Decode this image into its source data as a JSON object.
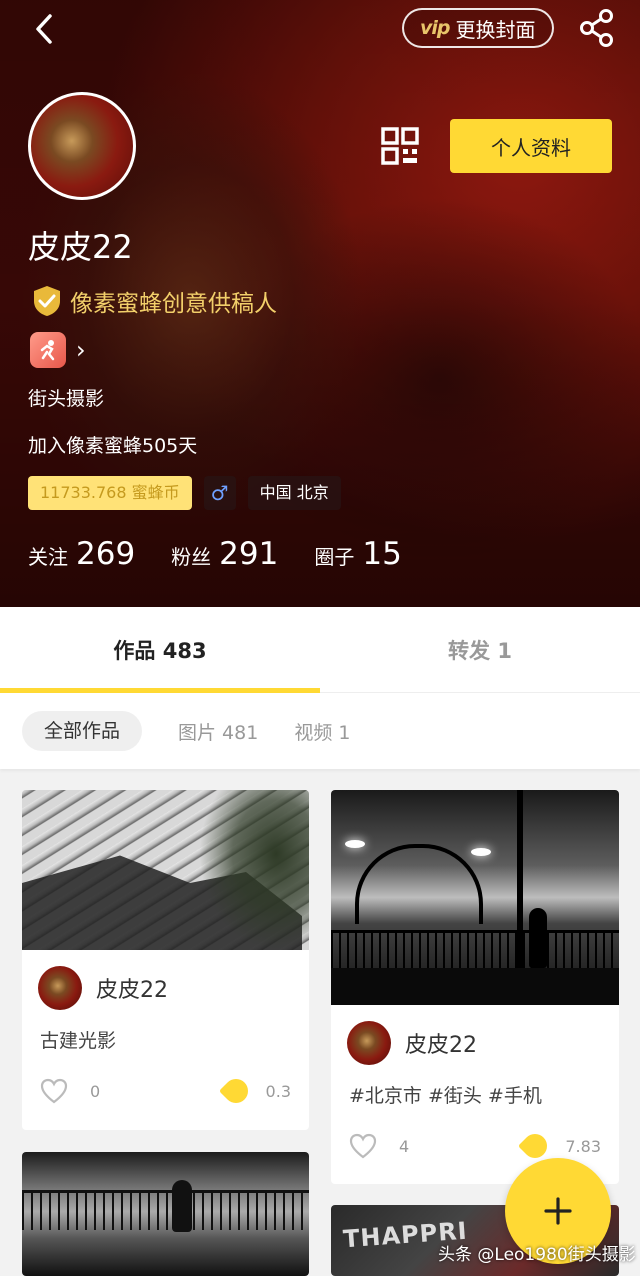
{
  "header": {
    "back_icon": "chevron-left-icon",
    "vip_badge": "vip",
    "change_cover_label": "更换封面",
    "share_icon": "share-icon",
    "qr_icon": "qr-code-icon",
    "profile_button_label": "个人资料"
  },
  "profile": {
    "username": "皮皮22",
    "verified_title": "像素蜜蜂创意供稿人",
    "tag": "街头摄影",
    "joined": "加入像素蜜蜂505天",
    "coins": "11733.768 蜜蜂币",
    "gender_symbol": "♂",
    "location": "中国 北京",
    "stats": [
      {
        "label": "关注",
        "value": "269"
      },
      {
        "label": "粉丝",
        "value": "291"
      },
      {
        "label": "圈子",
        "value": "15"
      }
    ]
  },
  "tabs": [
    {
      "label": "作品 483",
      "active": true
    },
    {
      "label": "转发 1",
      "active": false
    }
  ],
  "filters": [
    "全部作品",
    "图片 481",
    "视频 1"
  ],
  "cards": [
    {
      "author": "皮皮22",
      "title": "古建光影",
      "likes": "0",
      "coins": "0.3"
    },
    {
      "author": "皮皮22",
      "title": "#北京市 #街头 #手机",
      "likes": "4",
      "coins": "7.83"
    }
  ],
  "card4_photo_text": "THAPPRI",
  "fab_icon": "plus-icon",
  "watermark": "头条 @Leo1980街头摄影",
  "colors": {
    "accent": "#ffd934",
    "verify": "#f2cf6a"
  }
}
